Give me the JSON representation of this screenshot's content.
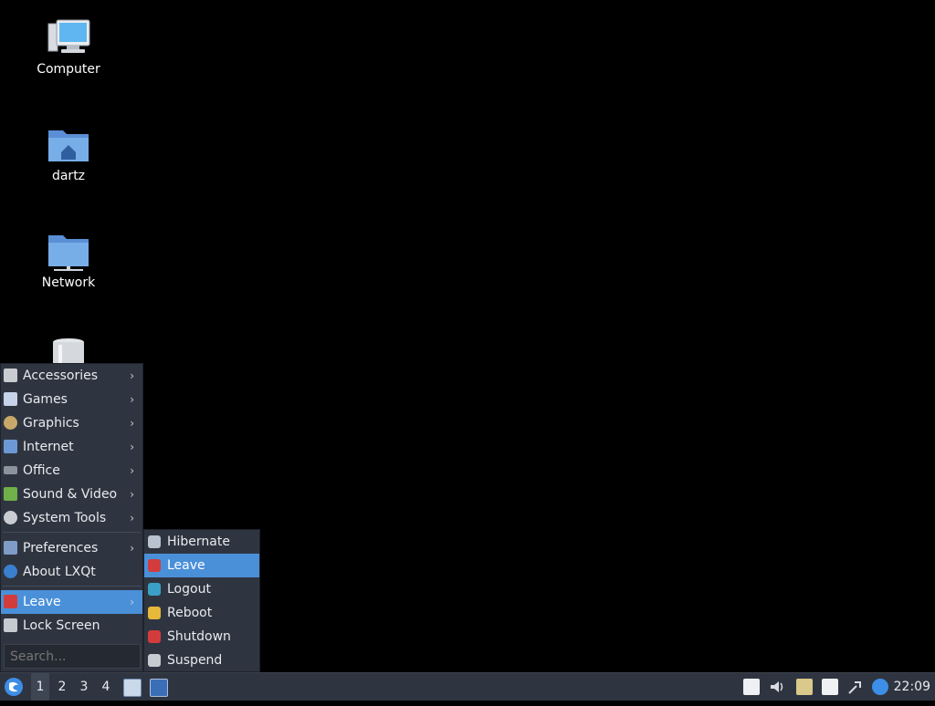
{
  "desktop": {
    "icons": [
      {
        "label": "Computer",
        "icon": "computer-icon"
      },
      {
        "label": "dartz",
        "icon": "home-folder-icon"
      },
      {
        "label": "Network",
        "icon": "network-folder-icon"
      },
      {
        "label": "",
        "icon": "trash-icon"
      }
    ]
  },
  "menu": {
    "items": [
      {
        "label": "Accessories",
        "icon": "accessories-icon",
        "has_submenu": true
      },
      {
        "label": "Games",
        "icon": "games-icon",
        "has_submenu": true
      },
      {
        "label": "Graphics",
        "icon": "graphics-icon",
        "has_submenu": true
      },
      {
        "label": "Internet",
        "icon": "internet-icon",
        "has_submenu": true
      },
      {
        "label": "Office",
        "icon": "office-icon",
        "has_submenu": true
      },
      {
        "label": "Sound & Video",
        "icon": "sound-video-icon",
        "has_submenu": true
      },
      {
        "label": "System Tools",
        "icon": "system-tools-icon",
        "has_submenu": true
      },
      {
        "label": "Preferences",
        "icon": "preferences-icon",
        "has_submenu": true
      },
      {
        "label": "About LXQt",
        "icon": "about-icon",
        "has_submenu": false
      },
      {
        "label": "Leave",
        "icon": "leave-icon",
        "has_submenu": true,
        "active": true
      },
      {
        "label": "Lock Screen",
        "icon": "lock-icon",
        "has_submenu": false
      }
    ],
    "arrow": "›",
    "search_placeholder": "Search..."
  },
  "leave_submenu": {
    "items": [
      {
        "label": "Hibernate",
        "icon": "hibernate-icon"
      },
      {
        "label": "Leave",
        "icon": "leave-icon",
        "active": true
      },
      {
        "label": "Logout",
        "icon": "logout-icon"
      },
      {
        "label": "Reboot",
        "icon": "reboot-icon"
      },
      {
        "label": "Shutdown",
        "icon": "shutdown-icon"
      },
      {
        "label": "Suspend",
        "icon": "suspend-icon"
      }
    ]
  },
  "taskbar": {
    "workspaces": [
      "1",
      "2",
      "3",
      "4"
    ],
    "current_workspace": "1",
    "clock": "22:09"
  },
  "colors": {
    "menu_bg": "#2f3540",
    "highlight": "#4a90d9",
    "desktop_bg": "#000000"
  }
}
